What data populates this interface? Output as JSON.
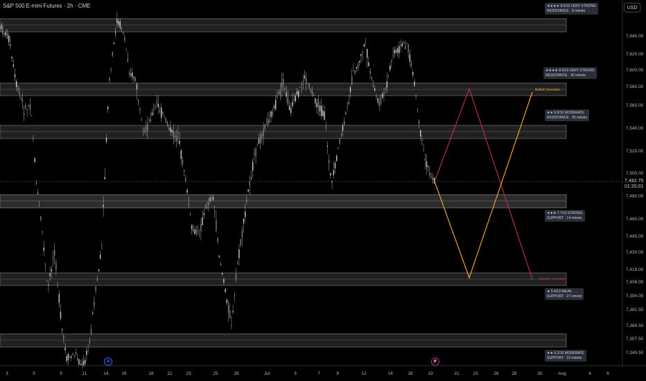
{
  "header": {
    "symbol_title": "S&P 500 E-mini Futures · 2h · CME",
    "currency_button": "USD"
  },
  "price_axis": {
    "ticks": [
      "7,640.00",
      "7,620.00",
      "7,600.00",
      "7,580.00",
      "7,560.00",
      "7,540.00",
      "7,520.00",
      "7,500.00",
      "7,480.00",
      "7,460.00",
      "7,445.00",
      "7,430.00",
      "7,418.00",
      "7,406.00",
      "7,394.00",
      "7,381.50",
      "7,369.50",
      "7,357.50",
      "7,345.50"
    ],
    "last_price": "7,492.75",
    "countdown": "01:20:01"
  },
  "time_axis": {
    "ticks": [
      "3",
      "5",
      "9",
      "11",
      "14",
      "16",
      "18",
      "21",
      "23",
      "25",
      "28",
      "Jul",
      "3",
      "7",
      "9",
      "12",
      "14",
      "16",
      "19",
      "21",
      "23",
      "26",
      "28",
      "30",
      "Aug",
      "4",
      "6"
    ]
  },
  "zones": [
    {
      "name": "zone-resistance-top",
      "top_label": [
        "★★★★ 8.5/10  VERY STRONG",
        "RESISTANCE  ·  8 retests"
      ]
    },
    {
      "name": "zone-resistance-2",
      "top_label": [
        "★★★★ 8.0/10  VERY STRONG",
        "RESISTANCE  ·  30 retests"
      ]
    },
    {
      "name": "zone-resistance-3",
      "top_label": [
        "★★ 6.9/10  MODERATE",
        "RESISTANCE  ·  35 retests"
      ]
    },
    {
      "name": "zone-support-1",
      "top_label": [
        "★★★ 7.7/10  STRONG",
        "SUPPORT  ·  14 retests"
      ]
    },
    {
      "name": "zone-support-2",
      "top_label": [
        "★ 5.4/10  WEAK",
        "SUPPORT  ·  27 retests"
      ]
    },
    {
      "name": "zone-support-3",
      "top_label": [
        "★★ 6.2/10  MODERATE",
        "SUPPORT  ·  10 retests"
      ]
    }
  ],
  "scenarios": {
    "bullish": "Bullish Scenario",
    "bearish": "Bearish Scenario"
  },
  "events": [
    {
      "name": "economic-event-icon",
      "glyph": "26"
    },
    {
      "name": "earnings-event-icon",
      "glyph": "⚡"
    }
  ],
  "colors": {
    "background": "#000000",
    "candle": "#b2b5be",
    "zone_fill": "#3a3a3a",
    "zone_border": "#6b6b6b",
    "bullish": "#e8a33d",
    "bearish": "#b2323c",
    "event_blue": "#2962ff",
    "event_purple": "#9c27b0"
  }
}
